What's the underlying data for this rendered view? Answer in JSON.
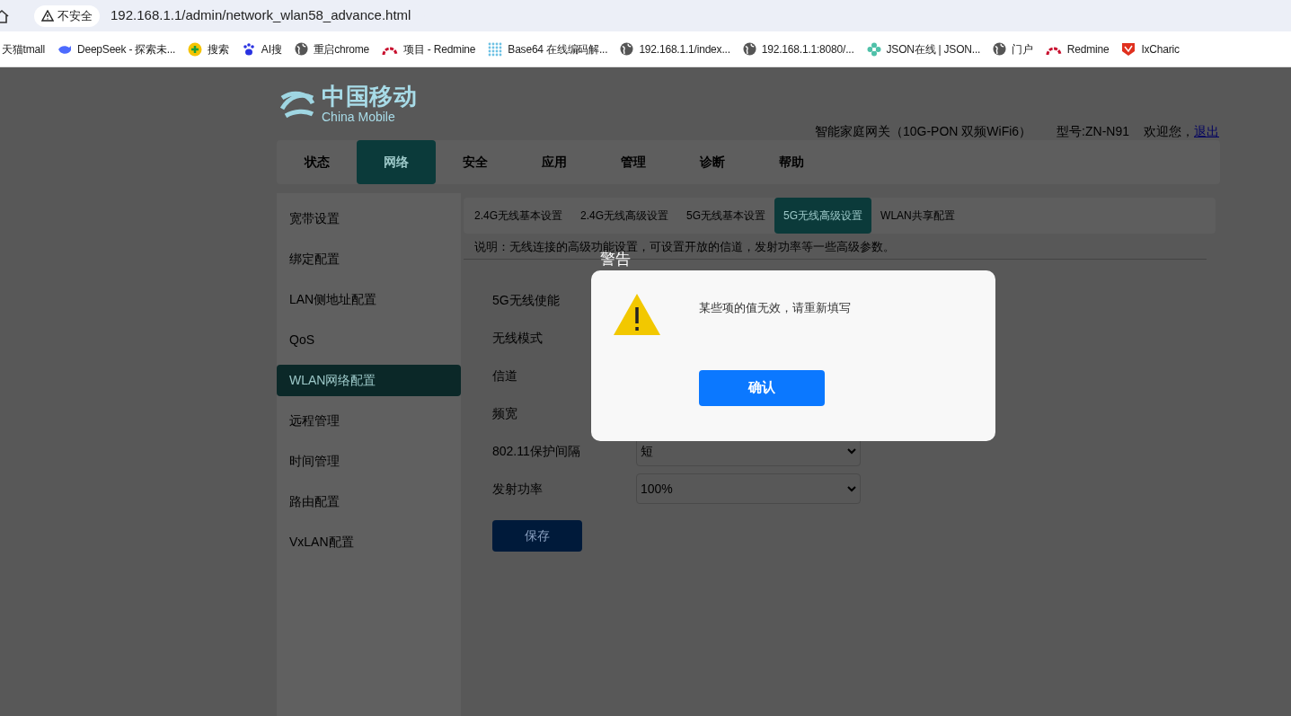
{
  "browser": {
    "security": "不安全",
    "url": "192.168.1.1/admin/network_wlan58_advance.html",
    "bookmarks": [
      {
        "label": "天猫tmall"
      },
      {
        "label": "DeepSeek - 探索未..."
      },
      {
        "label": "搜索"
      },
      {
        "label": "AI搜"
      },
      {
        "label": "重启chrome"
      },
      {
        "label": "项目 - Redmine"
      },
      {
        "label": "Base64 在线编码解..."
      },
      {
        "label": "192.168.1.1/index..."
      },
      {
        "label": "192.168.1.1:8080/..."
      },
      {
        "label": "JSON在线 | JSON..."
      },
      {
        "label": "门户"
      },
      {
        "label": "Redmine"
      },
      {
        "label": "IxCharic"
      }
    ]
  },
  "header": {
    "logo_cn": "中国移动",
    "logo_en": "China Mobile",
    "product": "智能家庭网关（10G-PON 双频WiFi6）",
    "model": "型号:ZN-N91",
    "welcome": "欢迎您，",
    "logout": "退出"
  },
  "nav": [
    {
      "label": "状态",
      "selected": false
    },
    {
      "label": "网络",
      "selected": true
    },
    {
      "label": "安全",
      "selected": false
    },
    {
      "label": "应用",
      "selected": false
    },
    {
      "label": "管理",
      "selected": false
    },
    {
      "label": "诊断",
      "selected": false
    },
    {
      "label": "帮助",
      "selected": false
    }
  ],
  "sidebar": [
    {
      "label": "宽带设置",
      "selected": false
    },
    {
      "label": "绑定配置",
      "selected": false
    },
    {
      "label": "LAN侧地址配置",
      "selected": false
    },
    {
      "label": "QoS",
      "selected": false
    },
    {
      "label": "WLAN网络配置",
      "selected": true
    },
    {
      "label": "远程管理",
      "selected": false
    },
    {
      "label": "时间管理",
      "selected": false
    },
    {
      "label": "路由配置",
      "selected": false
    },
    {
      "label": "VxLAN配置",
      "selected": false
    }
  ],
  "subtabs": [
    {
      "label": "2.4G无线基本设置",
      "selected": false
    },
    {
      "label": "2.4G无线高级设置",
      "selected": false
    },
    {
      "label": "5G无线基本设置",
      "selected": false
    },
    {
      "label": "5G无线高级设置",
      "selected": true
    },
    {
      "label": "WLAN共享配置",
      "selected": false
    }
  ],
  "description": "说明：无线连接的高级功能设置，可设置开放的信道，发射功率等一些高级参数。",
  "form": [
    {
      "label": "5G无线使能"
    },
    {
      "label": "无线模式"
    },
    {
      "label": "信道"
    },
    {
      "label": "频宽"
    },
    {
      "label": "802.11保护间隔",
      "value": "短"
    },
    {
      "label": "发射功率",
      "value": "100%"
    }
  ],
  "save_button": "保存",
  "dialog": {
    "title": "警告",
    "message": "某些项的值无效，请重新填写",
    "confirm": "确认"
  }
}
